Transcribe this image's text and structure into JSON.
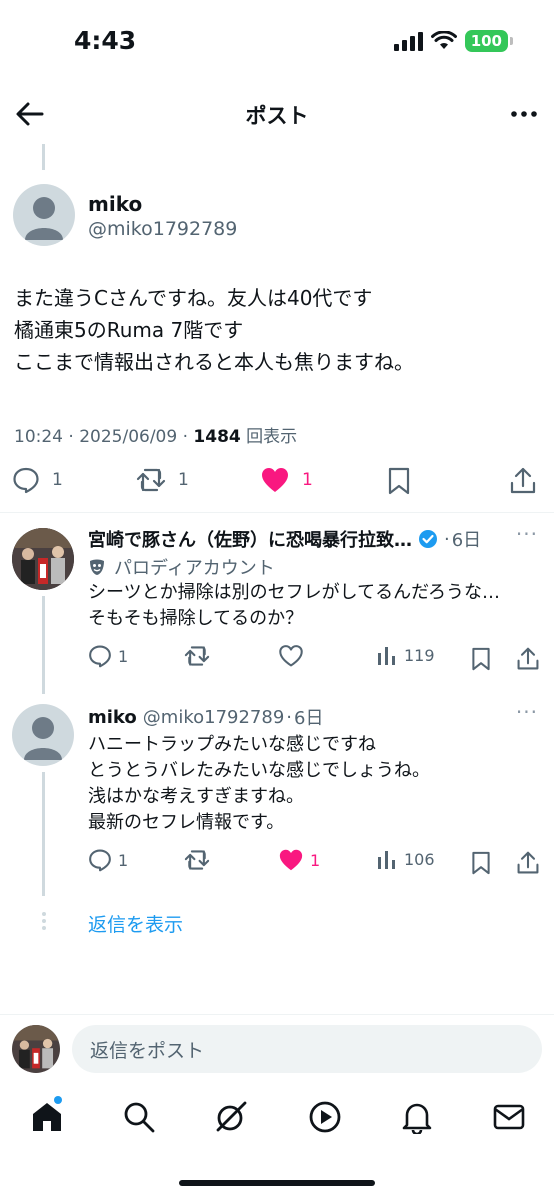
{
  "status_bar": {
    "time": "4:43",
    "battery": "100"
  },
  "header": {
    "title": "ポスト"
  },
  "main_post": {
    "name": "miko",
    "handle": "@miko1792789",
    "lines": [
      "また違うCさんですね。友人は40代です",
      "橘通東5のRuma 7階です",
      "ここまで情報出されると本人も焦りますね。"
    ],
    "time": "10:24 · 2025/06/09 · ",
    "views": "1484",
    "views_label": "回表示",
    "replies": "1",
    "reposts": "1",
    "likes": "1"
  },
  "replies": [
    {
      "name": "宮崎で豚さん（佐野）に恐喝暴行拉致…",
      "age": "6日",
      "parody_label": "パロディアカウント",
      "lines": [
        "シーツとか掃除は別のセフレがしてるんだろうな…",
        "そもそも掃除してるのか？"
      ],
      "replies": "1",
      "views": "119",
      "likes": ""
    },
    {
      "name": "miko",
      "handle": "@miko1792789",
      "age": "6日",
      "lines": [
        "ハニートラップみたいな感じですね",
        "とうとうバレたみたいな感じでしょうね。",
        "浅はかな考えすぎますね。",
        "最新のセフレ情報です。"
      ],
      "replies": "1",
      "likes": "1",
      "views": "106"
    }
  ],
  "show_replies": "返信を表示",
  "compose": {
    "placeholder": "返信をポスト"
  },
  "colors": {
    "accent": "#1d9bf0",
    "like": "#f91880",
    "verified": "#1d9bf0",
    "muted": "#536471"
  }
}
